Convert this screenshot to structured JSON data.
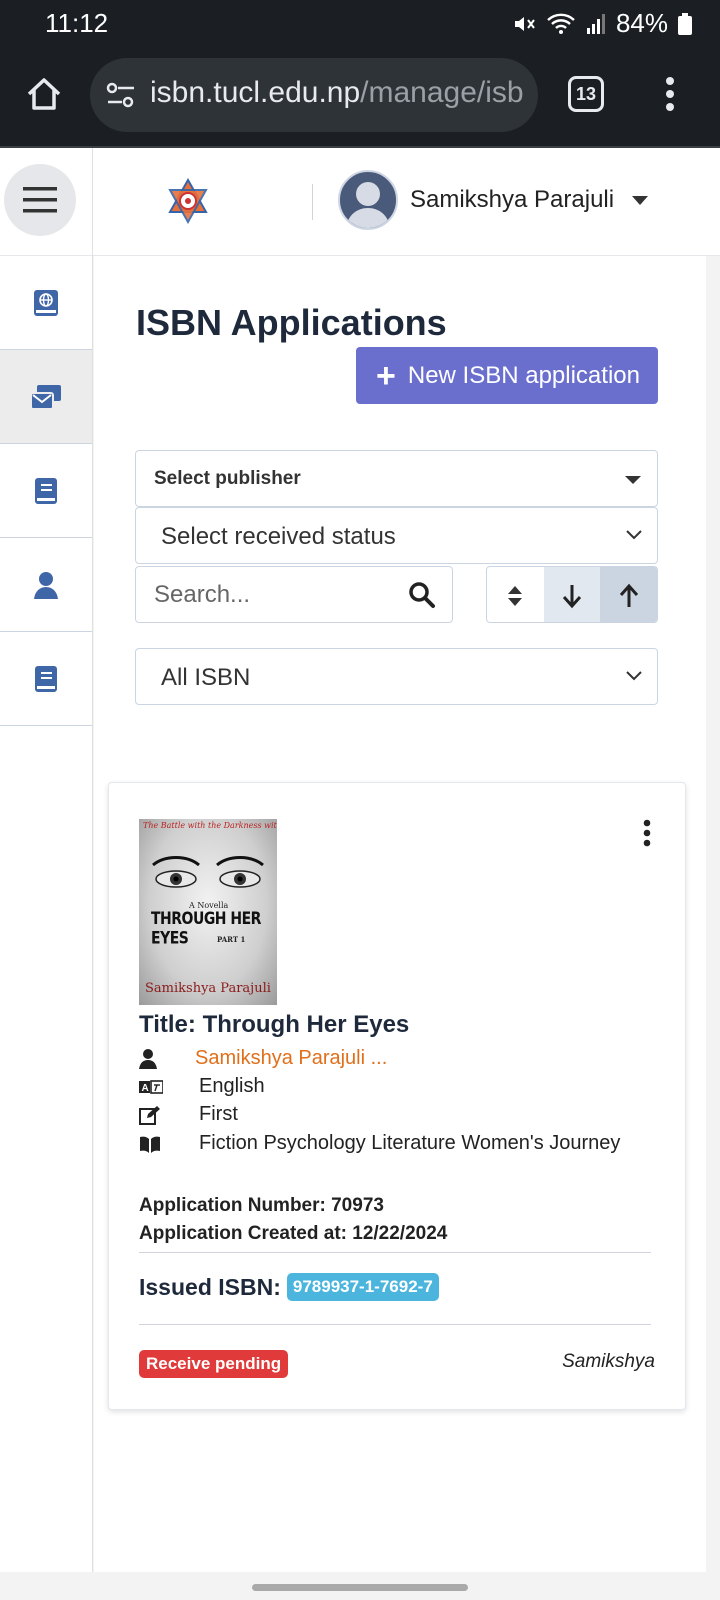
{
  "status_bar": {
    "time": "11:12",
    "battery": "84%"
  },
  "browser": {
    "url_main": "isbn.tucl.edu.np",
    "url_path": "/manage/isb",
    "tab_count": "13"
  },
  "header": {
    "user_name": "Samikshya Parajuli"
  },
  "sidebar": {
    "items": [
      {
        "icon": "globe-book-icon"
      },
      {
        "icon": "mail-tray-icon",
        "active": true
      },
      {
        "icon": "book-icon"
      },
      {
        "icon": "user-icon"
      },
      {
        "icon": "book-icon"
      }
    ]
  },
  "main": {
    "title": "ISBN Applications",
    "new_button": "New ISBN application",
    "publisher_select": "Select publisher",
    "status_select": "Select received status",
    "search_placeholder": "Search...",
    "isbn_filter": "All ISBN"
  },
  "card": {
    "cover": {
      "tagline": "The Battle with the Darkness within",
      "novella": "A Novella",
      "title": "THROUGH HER EYES",
      "part": "PART 1",
      "author": "Samikshya Parajuli"
    },
    "title": "Title: Through Her Eyes",
    "author": "Samikshya Parajuli ...",
    "language": "English",
    "edition": "First",
    "genres": "Fiction Psychology Literature Women's Journey",
    "application_number": "Application Number: 70973",
    "application_created": "Application Created at: 12/22/2024",
    "issued_label": "Issued ISBN:",
    "issued_isbn": "9789937-1-7692-7",
    "status_badge": "Receive pending",
    "owner": "Samikshya"
  },
  "colors": {
    "accent": "#6a6fce",
    "isbn_badge": "#4cb5dd",
    "pending_badge": "#e03a3a",
    "author_link": "#e16f1a",
    "sidebar_icon": "#3f66a6"
  }
}
